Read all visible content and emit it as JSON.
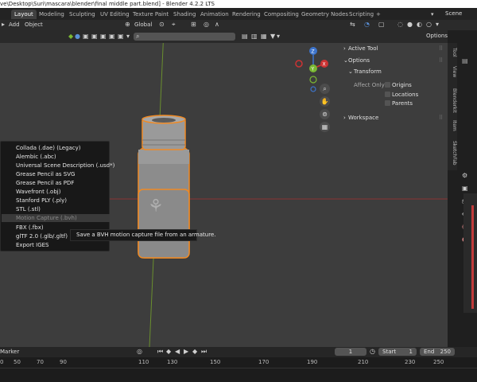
{
  "window": {
    "title": "ve\\Desktop\\Suri\\mascara\\blender\\final middle part.blend] - Blender 4.2.2 LTS"
  },
  "workspaces": [
    "Layout",
    "Modeling",
    "Sculpting",
    "UV Editing",
    "Texture Paint",
    "Shading",
    "Animation",
    "Rendering",
    "Compositing",
    "Geometry Nodes",
    "Scripting",
    "+"
  ],
  "scene_label": "Scene",
  "header_menu": {
    "add": "Add",
    "object": "Object"
  },
  "transform": {
    "orientation": "Global"
  },
  "options_button": "Options",
  "npanel": {
    "active_tool": "Active Tool",
    "options": "Options",
    "transform": "Transform",
    "affect_only": "Affect Only",
    "origins": "Origins",
    "locations": "Locations",
    "parents": "Parents",
    "workspace": "Workspace",
    "tabs": [
      "Tool",
      "View",
      "Blenderkit",
      "Item",
      "SketchFab"
    ]
  },
  "gizmo": {
    "x": "X",
    "y": "Y",
    "z": "Z"
  },
  "export_menu": {
    "items": [
      "Collada (.dae) (Legacy)",
      "Alembic (.abc)",
      "Universal Scene Description (.usd*)",
      "Grease Pencil as SVG",
      "Grease Pencil as PDF",
      "Wavefront (.obj)",
      "Stanford PLY (.ply)",
      "STL (.stl)",
      "Motion Capture (.bvh)",
      "FBX (.fbx)",
      "glTF 2.0 (.glb/.gltf)",
      "Export IGES"
    ],
    "highlighted_index": 8
  },
  "tooltip": "Save a BVH motion capture file from an armature.",
  "timeline": {
    "marker": "Marker",
    "current_frame": "1",
    "start_label": "Start",
    "start": "1",
    "end_label": "End",
    "end": "250"
  },
  "ruler_ticks": [
    "0",
    "50",
    "70",
    "90",
    "110",
    "130",
    "150",
    "170",
    "190",
    "210",
    "230",
    "250"
  ],
  "colors": {
    "accent": "#4772b3",
    "selection_outline": "#f08a24",
    "x_axis": "#cc3333",
    "y_axis": "#7ab833",
    "z_axis": "#3d74cc"
  }
}
